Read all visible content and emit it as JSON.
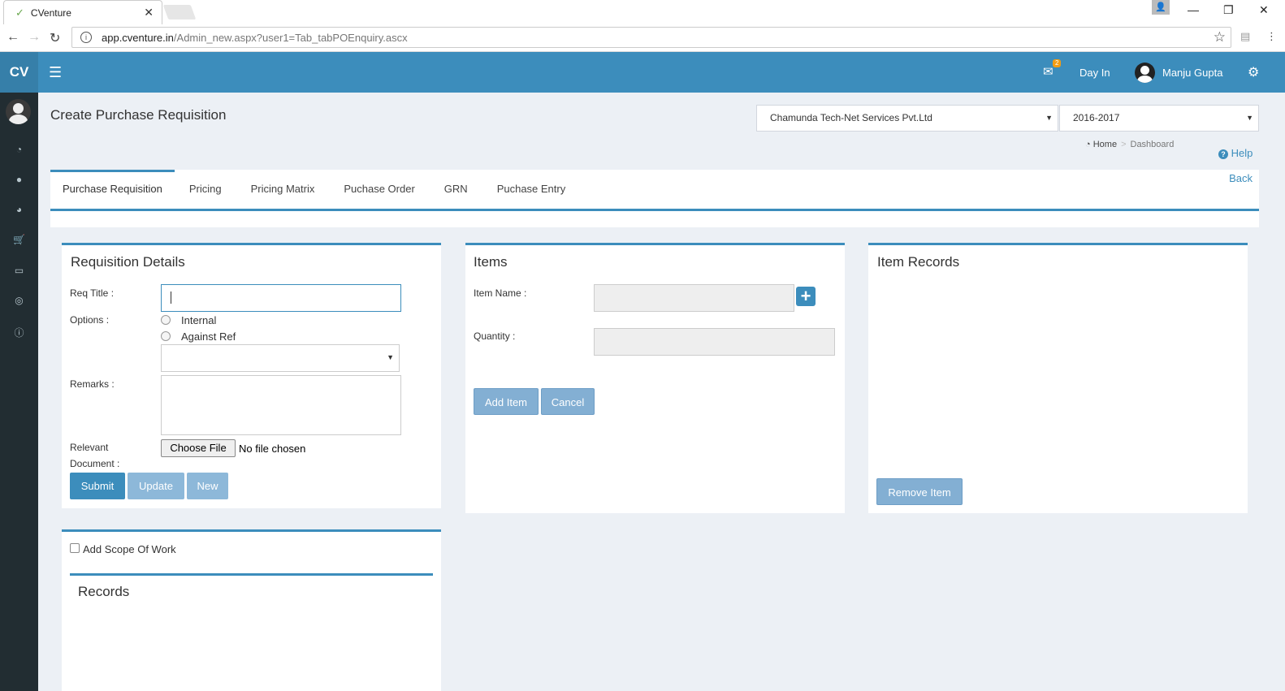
{
  "browser": {
    "tab_title": "CVenture",
    "url_domain": "app.cventure.in",
    "url_path": "/Admin_new.aspx?user1=Tab_tabPOEnquiry.ascx"
  },
  "header": {
    "logo": "CV",
    "notification_count": "2",
    "day_in_label": "Day In",
    "user_name": "Manju Gupta"
  },
  "page": {
    "title": "Create Purchase Requisition",
    "company_select": "Chamunda Tech-Net Services Pvt.Ltd",
    "year_select": "2016-2017",
    "breadcrumb": [
      "Home",
      "Dashboard"
    ],
    "help_label": "Help",
    "back_label": "Back"
  },
  "tabs": [
    "Purchase Requisition",
    "Pricing",
    "Pricing Matrix",
    "Puchase Order",
    "GRN",
    "Puchase Entry"
  ],
  "requisition": {
    "title": "Requisition Details",
    "req_title_label": "Req Title :",
    "options_label": "Options :",
    "option_internal": "Internal",
    "option_against_ref": "Against Ref",
    "remarks_label": "Remarks :",
    "relevant_doc_label_1": "Relevant",
    "relevant_doc_label_2": "Document :",
    "choose_file_label": "Choose File",
    "no_file_label": "No file chosen",
    "submit_label": "Submit",
    "update_label": "Update",
    "new_label": "New"
  },
  "items": {
    "title": "Items",
    "item_name_label": "Item Name :",
    "quantity_label": "Quantity :",
    "add_item_label": "Add Item",
    "cancel_label": "Cancel"
  },
  "item_records": {
    "title": "Item Records",
    "remove_item_label": "Remove Item"
  },
  "scope": {
    "add_scope_label": "Add Scope Of Work",
    "records_title": "Records"
  },
  "colors": {
    "header_blue": "#3c8dbc",
    "sidebar_dark": "#222d32",
    "content_bg": "#ecf0f5"
  }
}
